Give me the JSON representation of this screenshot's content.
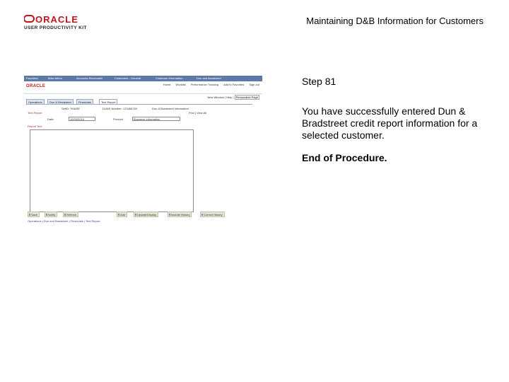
{
  "logo": {
    "brand": "ORACLE",
    "product": "USER PRODUCTIVITY KIT"
  },
  "header": {
    "title": "Maintaining D&B Information for Customers"
  },
  "step": {
    "label": "Step 81"
  },
  "description": "You have successfully entered Dun & Bradstreet credit report information for a selected customer.",
  "end_text": "End of Procedure.",
  "screenshot": {
    "nav_items": [
      "Favorites",
      "Main Menu",
      "Accounts Receivable",
      "Customers - General",
      "Customer Information",
      "Dun and Bradstreet"
    ],
    "brand": "ORACLE",
    "sub_links": [
      "Home",
      "Worklist",
      "Performance Tracking",
      "Add to Favorites",
      "Sign out"
    ],
    "tools": [
      "New Window",
      "Help",
      "Personalize Page"
    ],
    "tabs": [
      "Operations",
      "Dun & Bradstreet",
      "Financials",
      "Text Report"
    ],
    "set_id": "SetID: SHARE",
    "duns_number": "DUNS Number: 123456789",
    "header_note": "Dun & Bradstreet Information",
    "nav_find": "Find | View All",
    "section_title": "Text Report",
    "field_label": "Date:",
    "field_value": "10/20/2010",
    "product_label": "Product:",
    "product_value": "Business Information",
    "report_label": "Report Text",
    "buttons": [
      "Save",
      "Notify",
      "Refresh",
      "Add",
      "Update/Display",
      "Include History",
      "Correct History"
    ],
    "bottom_links": "Operations | Dun and Bradstreet | Financials | Text Report"
  },
  "colors": {
    "oracle_red": "#c2141b",
    "nav_blue": "#5d79a8"
  }
}
